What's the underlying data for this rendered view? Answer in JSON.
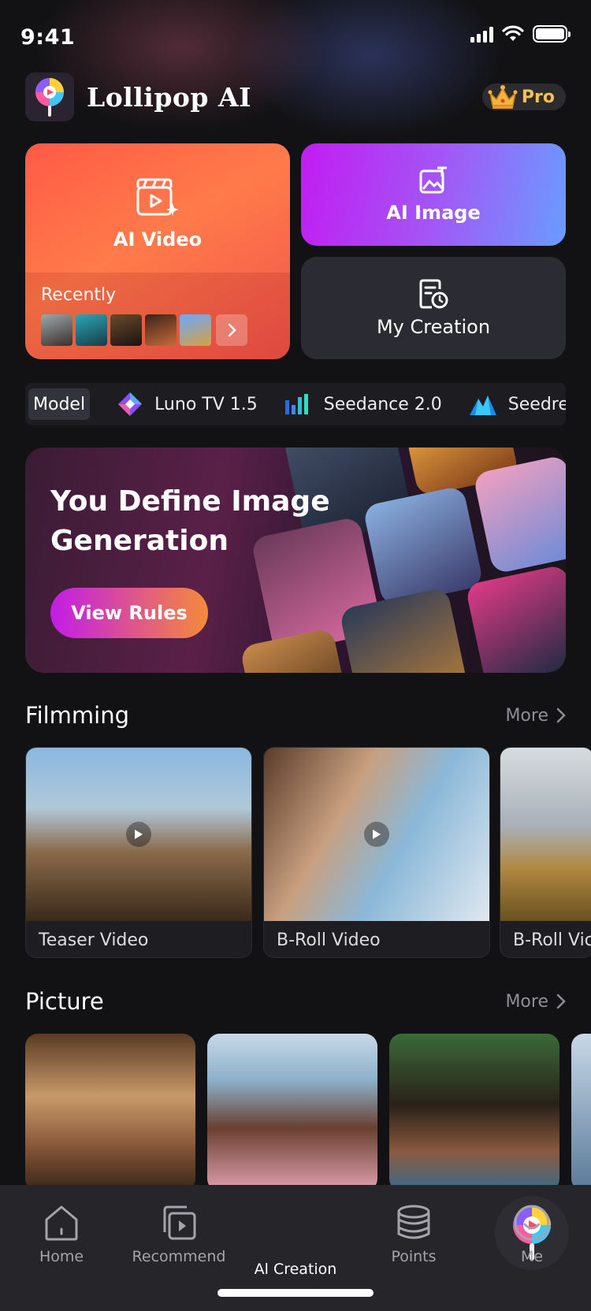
{
  "status_bar": {
    "time": "9:41"
  },
  "header": {
    "app_title": "Lollipop AI",
    "pro_label": "Pro"
  },
  "tiles": {
    "ai_video": "AI Video",
    "recently": "Recently",
    "ai_image": "AI Image",
    "my_creation": "My Creation"
  },
  "models": {
    "chip": "Model",
    "items": [
      "Luno TV 1.5",
      "Seedance 2.0",
      "Seedrea"
    ]
  },
  "banner": {
    "title": "You Define Image Generation",
    "button": "View Rules"
  },
  "filmming": {
    "title": "Filmming",
    "more": "More",
    "cards": [
      "Teaser Video",
      "B-Roll Video",
      "B-Roll Vic"
    ]
  },
  "picture": {
    "title": "Picture",
    "more": "More"
  },
  "tabbar": {
    "home": "Home",
    "recommend": "Recommend",
    "ai_creation": "Al Creation",
    "points": "Points",
    "me": "Me"
  },
  "colors": {
    "background": "#121214",
    "video_card": "#ff6a4a",
    "image_card_start": "#c21cf2",
    "image_card_end": "#6a9cff",
    "pro_gold": "#f4c24a",
    "tab_bar": "#25252a"
  }
}
